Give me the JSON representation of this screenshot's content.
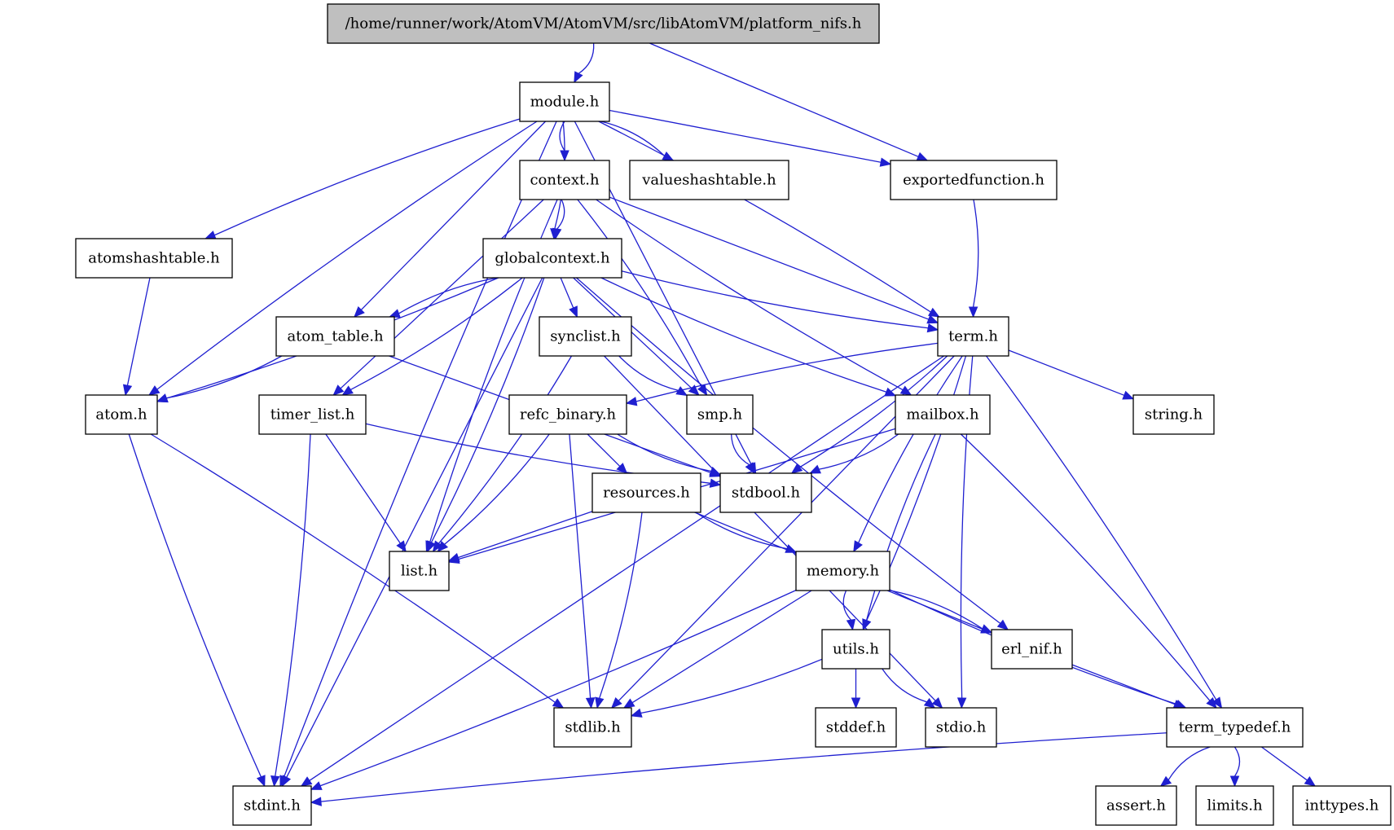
{
  "diagram": {
    "type": "include-dependency-graph",
    "colors": {
      "edge": "#1f1fd0",
      "root_fill": "#bfbfbf",
      "node_fill": "#ffffff",
      "border": "#000000"
    },
    "root": "/home/runner/work/AtomVM/AtomVM/src/libAtomVM/platform_nifs.h",
    "nodes": [
      {
        "id": "root",
        "label": "/home/runner/work/AtomVM/AtomVM/src/libAtomVM/platform_nifs.h"
      },
      {
        "id": "module",
        "label": "module.h"
      },
      {
        "id": "context",
        "label": "context.h"
      },
      {
        "id": "valueshashtable",
        "label": "valueshashtable.h"
      },
      {
        "id": "exportedfunction",
        "label": "exportedfunction.h"
      },
      {
        "id": "atomshashtable",
        "label": "atomshashtable.h"
      },
      {
        "id": "globalcontext",
        "label": "globalcontext.h"
      },
      {
        "id": "atom_table",
        "label": "atom_table.h"
      },
      {
        "id": "synclist",
        "label": "synclist.h"
      },
      {
        "id": "term",
        "label": "term.h"
      },
      {
        "id": "atom",
        "label": "atom.h"
      },
      {
        "id": "timer_list",
        "label": "timer_list.h"
      },
      {
        "id": "refc_binary",
        "label": "refc_binary.h"
      },
      {
        "id": "smp",
        "label": "smp.h"
      },
      {
        "id": "mailbox",
        "label": "mailbox.h"
      },
      {
        "id": "string",
        "label": "string.h"
      },
      {
        "id": "resources",
        "label": "resources.h"
      },
      {
        "id": "stdbool",
        "label": "stdbool.h"
      },
      {
        "id": "list",
        "label": "list.h"
      },
      {
        "id": "memory",
        "label": "memory.h"
      },
      {
        "id": "utils",
        "label": "utils.h"
      },
      {
        "id": "erl_nif",
        "label": "erl_nif.h"
      },
      {
        "id": "stdlib",
        "label": "stdlib.h"
      },
      {
        "id": "stddef",
        "label": "stddef.h"
      },
      {
        "id": "stdio",
        "label": "stdio.h"
      },
      {
        "id": "term_typedef",
        "label": "term_typedef.h"
      },
      {
        "id": "stdint",
        "label": "stdint.h"
      },
      {
        "id": "assert",
        "label": "assert.h"
      },
      {
        "id": "limits",
        "label": "limits.h"
      },
      {
        "id": "inttypes",
        "label": "inttypes.h"
      }
    ],
    "edges": [
      [
        "root",
        "module"
      ],
      [
        "root",
        "exportedfunction"
      ],
      [
        "module",
        "context"
      ],
      [
        "module",
        "valueshashtable"
      ],
      [
        "module",
        "exportedfunction"
      ],
      [
        "module",
        "atomshashtable"
      ],
      [
        "module",
        "globalcontext"
      ],
      [
        "module",
        "atom_table"
      ],
      [
        "module",
        "atom"
      ],
      [
        "module",
        "term"
      ],
      [
        "module",
        "stdbool"
      ],
      [
        "module",
        "stdint"
      ],
      [
        "context",
        "globalcontext"
      ],
      [
        "context",
        "term"
      ],
      [
        "context",
        "mailbox"
      ],
      [
        "context",
        "smp"
      ],
      [
        "context",
        "timer_list"
      ],
      [
        "context",
        "list"
      ],
      [
        "exportedfunction",
        "term"
      ],
      [
        "atomshashtable",
        "atom"
      ],
      [
        "globalcontext",
        "atom_table"
      ],
      [
        "globalcontext",
        "atom"
      ],
      [
        "globalcontext",
        "synclist"
      ],
      [
        "globalcontext",
        "term"
      ],
      [
        "globalcontext",
        "timer_list"
      ],
      [
        "globalcontext",
        "smp"
      ],
      [
        "globalcontext",
        "mailbox"
      ],
      [
        "globalcontext",
        "list"
      ],
      [
        "globalcontext",
        "stdint"
      ],
      [
        "globalcontext",
        "erl_nif"
      ],
      [
        "atom_table",
        "atom"
      ],
      [
        "atom_table",
        "stdbool"
      ],
      [
        "synclist",
        "smp"
      ],
      [
        "synclist",
        "list"
      ],
      [
        "synclist",
        "stdio"
      ],
      [
        "term",
        "refc_binary"
      ],
      [
        "term",
        "stdbool"
      ],
      [
        "term",
        "string"
      ],
      [
        "term",
        "memory"
      ],
      [
        "term",
        "utils"
      ],
      [
        "term",
        "stdlib"
      ],
      [
        "term",
        "stdio"
      ],
      [
        "term",
        "term_typedef"
      ],
      [
        "term",
        "stdint"
      ],
      [
        "atom",
        "stdint"
      ],
      [
        "atom",
        "stdlib"
      ],
      [
        "timer_list",
        "list"
      ],
      [
        "timer_list",
        "stdbool"
      ],
      [
        "timer_list",
        "stdint"
      ],
      [
        "refc_binary",
        "resources"
      ],
      [
        "refc_binary",
        "stdbool"
      ],
      [
        "refc_binary",
        "list"
      ],
      [
        "refc_binary",
        "stdlib"
      ],
      [
        "smp",
        "stdbool"
      ],
      [
        "mailbox",
        "stdbool"
      ],
      [
        "mailbox",
        "list"
      ],
      [
        "mailbox",
        "utils"
      ],
      [
        "mailbox",
        "term_typedef"
      ],
      [
        "resources",
        "list"
      ],
      [
        "resources",
        "memory"
      ],
      [
        "resources",
        "stdlib"
      ],
      [
        "resources",
        "erl_nif"
      ],
      [
        "memory",
        "utils"
      ],
      [
        "memory",
        "erl_nif"
      ],
      [
        "memory",
        "stdlib"
      ],
      [
        "memory",
        "term_typedef"
      ],
      [
        "memory",
        "stdint"
      ],
      [
        "utils",
        "stddef"
      ],
      [
        "utils",
        "stdio"
      ],
      [
        "utils",
        "stdlib"
      ],
      [
        "erl_nif",
        "term_typedef"
      ],
      [
        "term_typedef",
        "assert"
      ],
      [
        "term_typedef",
        "limits"
      ],
      [
        "term_typedef",
        "inttypes"
      ],
      [
        "term_typedef",
        "stdint"
      ]
    ]
  }
}
